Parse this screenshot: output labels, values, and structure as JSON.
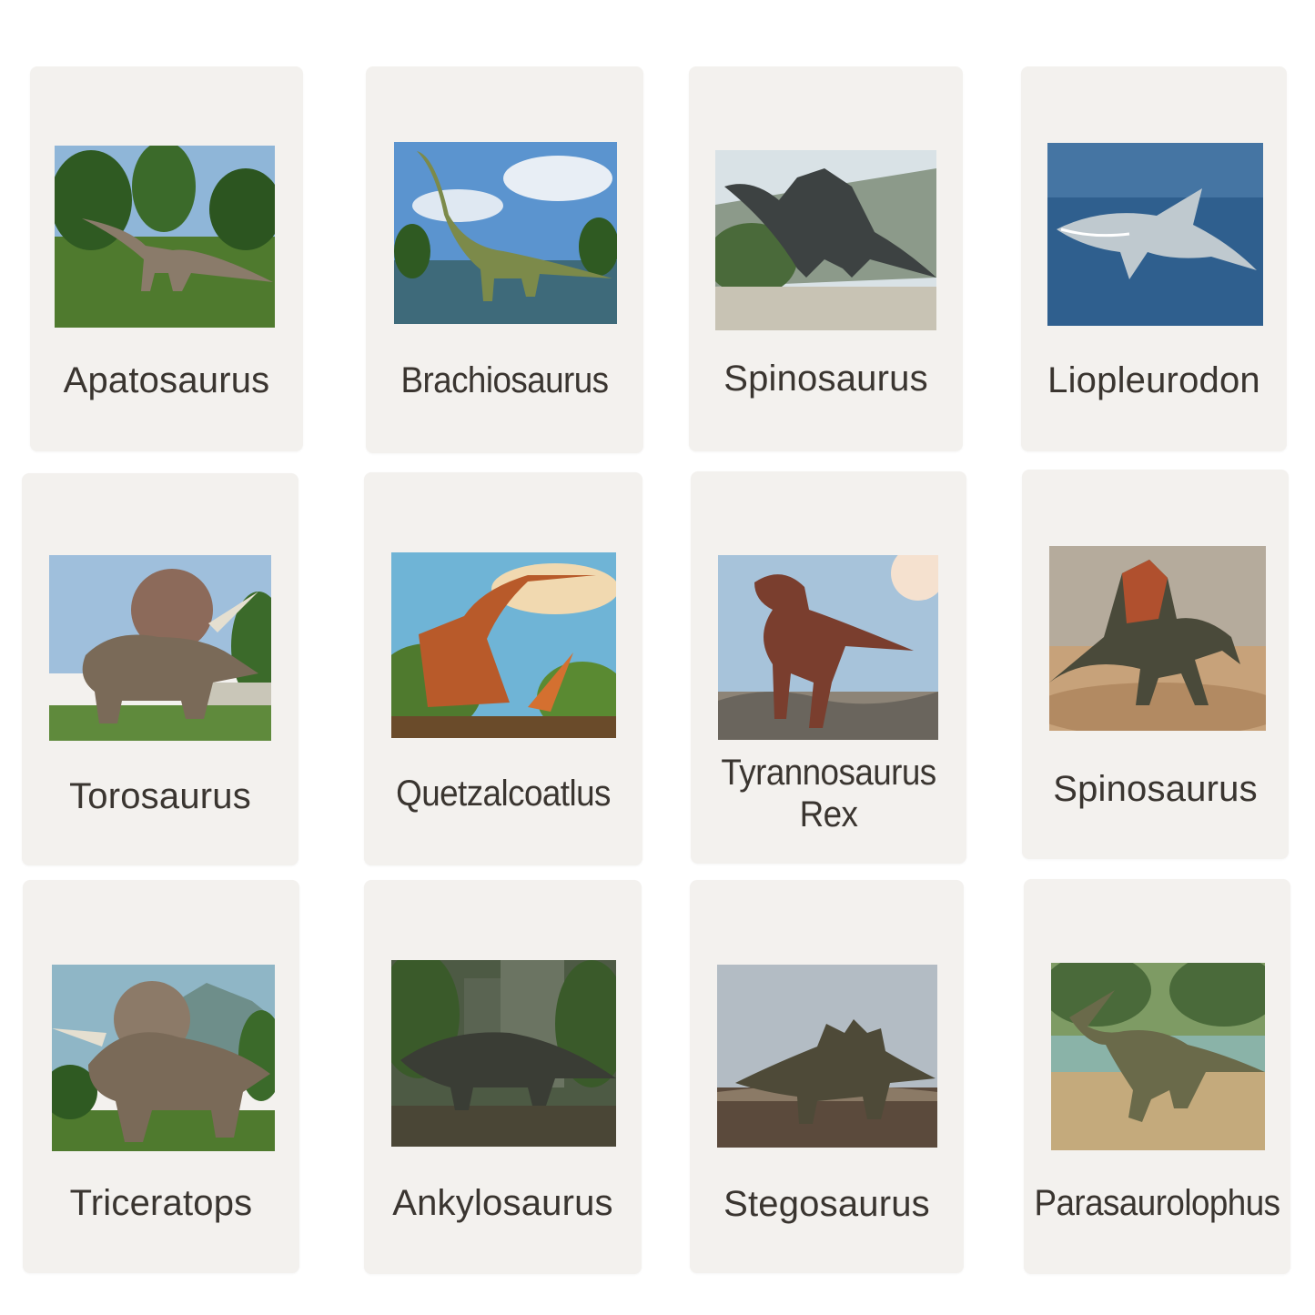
{
  "cards": [
    {
      "name": "Apatosaurus",
      "scene": "jungle-grass",
      "sky": "#8fb6d8",
      "ground": "#4f7a2e"
    },
    {
      "name": "Brachiosaurus",
      "scene": "lake-sky",
      "sky": "#5b94cf",
      "ground": "#3e6a7a"
    },
    {
      "name": "Spinosaurus",
      "scene": "cliff-sand",
      "sky": "#d9e2e6",
      "ground": "#c8c3b4"
    },
    {
      "name": "Liopleurodon",
      "scene": "ocean",
      "sky": "#2f5f8e",
      "ground": "#1e4a78"
    },
    {
      "name": "Torosaurus",
      "scene": "park",
      "sky": "#9fbfdc",
      "ground": "#5f8a3c"
    },
    {
      "name": "Quetzalcoatlus",
      "scene": "sunset-plants",
      "sky": "#6fb4d6",
      "ground": "#6a4b2a"
    },
    {
      "name": "Tyrannosaurus Rex",
      "scene": "desert-sky",
      "sky": "#a7c3da",
      "ground": "#8d8477"
    },
    {
      "name": "Spinosaurus",
      "scene": "desert-dust",
      "sky": "#b5ab9c",
      "ground": "#c7a27a"
    },
    {
      "name": "Triceratops",
      "scene": "jungle-grass",
      "sky": "#8fb6c6",
      "ground": "#4f7a2e"
    },
    {
      "name": "Ankylosaurus",
      "scene": "dark-jungle",
      "sky": "#4d5a44",
      "ground": "#4a4636"
    },
    {
      "name": "Stegosaurus",
      "scene": "plain",
      "sky": "#b3bcc4",
      "ground": "#5b4a3c"
    },
    {
      "name": "Parasaurolophus",
      "scene": "riverbank",
      "sky": "#7e9b64",
      "ground": "#c4aa7c"
    }
  ],
  "colors": {
    "card": "#f3f1ee",
    "text": "#3a3530",
    "background": "#ffffff"
  }
}
